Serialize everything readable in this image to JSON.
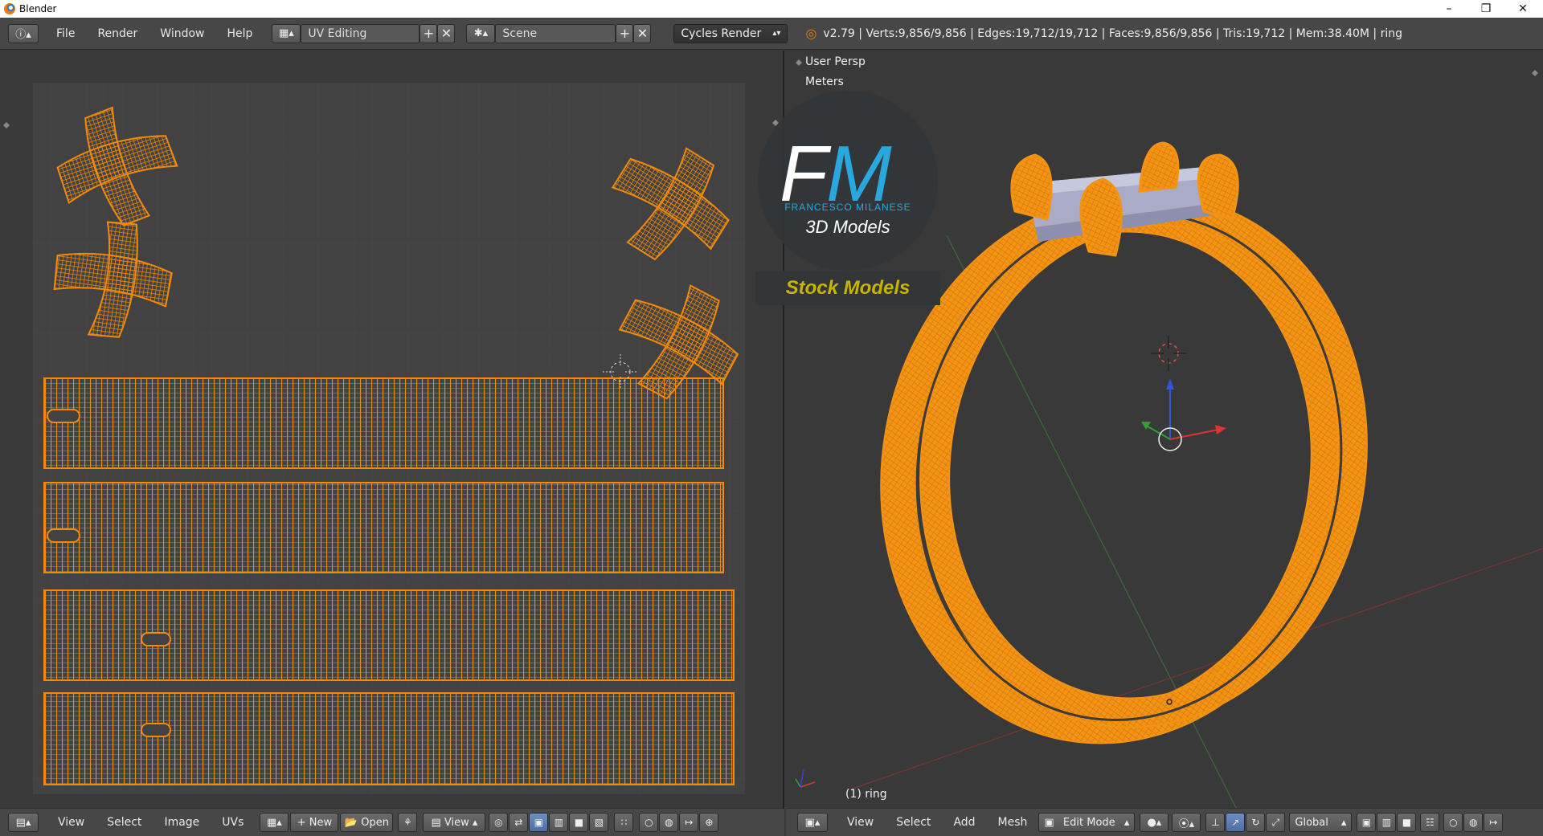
{
  "window": {
    "title": "Blender",
    "controls": [
      "minimize",
      "restore",
      "close"
    ]
  },
  "info_header": {
    "menus": [
      "File",
      "Render",
      "Window",
      "Help"
    ],
    "screen_layout": "UV Editing",
    "scene": "Scene",
    "render_engine": "Cycles Render",
    "stats": "v2.79 | Verts:9,856/9,856 | Edges:19,712/19,712 | Faces:9,856/9,856 | Tris:19,712 | Mem:38.40M | ring"
  },
  "uv_editor": {
    "menus": [
      "View",
      "Select",
      "Image",
      "UVs"
    ],
    "new_label": "New",
    "open_label": "Open",
    "view_label": "View",
    "uv_color": "#f28a0c",
    "grid_color": "#4a4a4a"
  },
  "viewport": {
    "view_name": "User Persp",
    "units": "Meters",
    "object_label": "(1) ring",
    "menus": [
      "View",
      "Select",
      "Add",
      "Mesh"
    ],
    "mode": "Edit Mode",
    "orientation": "Global",
    "mesh_color": "#f0900f"
  },
  "watermark": {
    "monogram": "FM",
    "author": "FRANCESCO MILANESE",
    "subtitle": "3D Models",
    "banner": "Stock Models",
    "accent": "#29a8e0",
    "banner_color": "#c8b400"
  }
}
